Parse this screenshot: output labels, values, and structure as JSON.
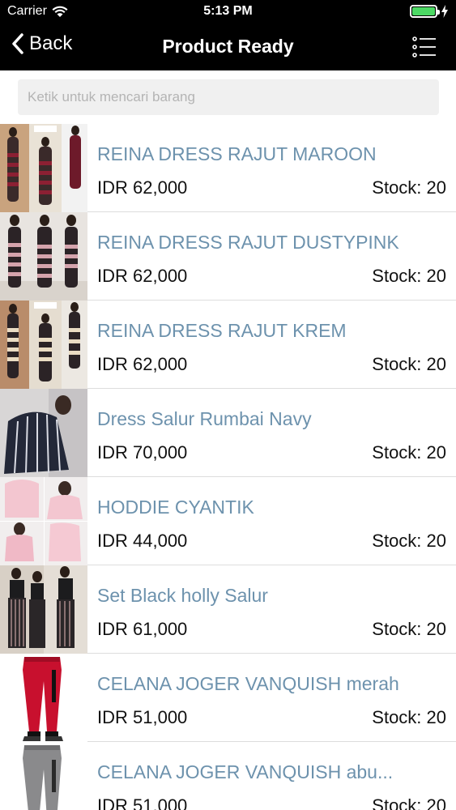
{
  "status_bar": {
    "carrier": "Carrier",
    "time": "5:13 PM",
    "battery_color": "#4cd964"
  },
  "nav": {
    "back_label": "Back",
    "title": "Product Ready",
    "menu_icon": "list-menu-icon"
  },
  "search": {
    "placeholder": "Ketik untuk mencari barang",
    "value": ""
  },
  "products": [
    {
      "name": "REINA DRESS RAJUT MAROON",
      "price": "IDR 62,000",
      "stock": "Stock: 20"
    },
    {
      "name": "REINA DRESS RAJUT DUSTYPINK",
      "price": "IDR 62,000",
      "stock": "Stock: 20"
    },
    {
      "name": "REINA DRESS RAJUT KREM",
      "price": "IDR 62,000",
      "stock": "Stock: 20"
    },
    {
      "name": "Dress Salur Rumbai Navy",
      "price": "IDR 70,000",
      "stock": "Stock: 20"
    },
    {
      "name": "HODDIE CYANTIK",
      "price": "IDR 44,000",
      "stock": "Stock: 20"
    },
    {
      "name": "Set Black holly Salur",
      "price": "IDR 61,000",
      "stock": "Stock: 20"
    },
    {
      "name": "CELANA JOGER VANQUISH merah",
      "price": "IDR 51,000",
      "stock": "Stock: 20"
    },
    {
      "name": "CELANA JOGER VANQUISH abu...",
      "price": "IDR 51,000",
      "stock": "Stock: 20"
    }
  ],
  "colors": {
    "nav_background": "#000000",
    "product_name": "#6d92ad",
    "separator": "#dddddd"
  }
}
